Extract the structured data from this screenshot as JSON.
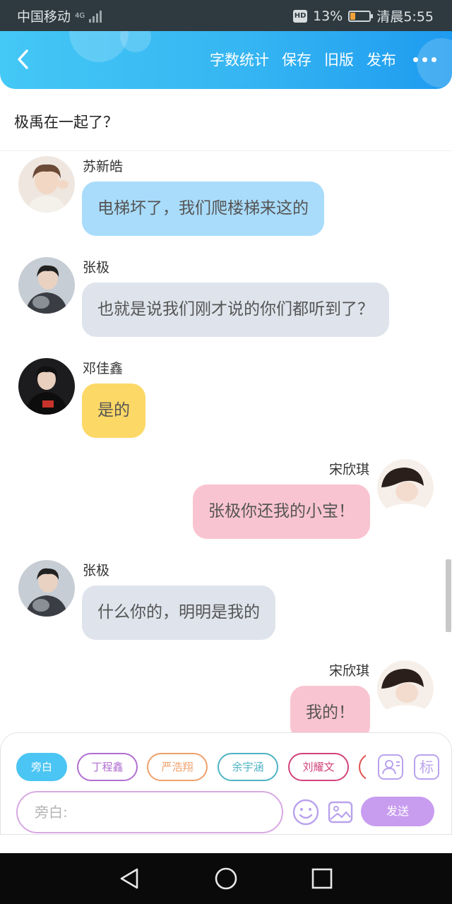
{
  "status_bar": {
    "carrier": "中国移动",
    "network": "4G",
    "battery_percent": "13%",
    "battery_level": 0.13,
    "time": "清晨5:55",
    "hd_badge": "HD"
  },
  "header": {
    "back_icon": "chevron-left-icon",
    "actions": [
      "字数统计",
      "保存",
      "旧版",
      "发布"
    ],
    "more_icon": "more-dots-icon"
  },
  "title": "极禹在一起了？",
  "messages": [
    {
      "side": "left",
      "name": "苏新皓",
      "text": "电梯坏了，我们爬楼梯来这的",
      "color": "#a9dcfb"
    },
    {
      "side": "left",
      "name": "张极",
      "text": "也就是说我们刚才说的你们都听到了？",
      "color": "#dfe4ec"
    },
    {
      "side": "left",
      "name": "邓佳鑫",
      "text": "是的",
      "color": "#fcd866"
    },
    {
      "side": "right",
      "name": "宋欣琪",
      "text": "张极你还我的小宝！",
      "color": "#f9c4d1"
    },
    {
      "side": "left",
      "name": "张极",
      "text": "什么你的，明明是我的",
      "color": "#dfe4ec"
    },
    {
      "side": "right",
      "name": "宋欣琪",
      "text": "我的！",
      "color": "#f9c4d1"
    }
  ],
  "roles": [
    {
      "label": "旁白",
      "color": "#4bc5f3",
      "active": true
    },
    {
      "label": "丁程鑫",
      "color": "#b06fd0",
      "active": false
    },
    {
      "label": "严浩翔",
      "color": "#f0a06a",
      "active": false
    },
    {
      "label": "余宇涵",
      "color": "#4fb3c4",
      "active": false
    },
    {
      "label": "刘耀文",
      "color": "#d2437a",
      "active": false
    }
  ],
  "tools": {
    "character_icon": "character-card-icon",
    "tag_label": "标"
  },
  "input": {
    "placeholder": "旁白:"
  },
  "buttons": {
    "emoji_icon": "emoji-icon",
    "image_icon": "image-icon",
    "send": "发送"
  },
  "nav": [
    "back-triangle-icon",
    "home-circle-icon",
    "recents-square-icon"
  ]
}
